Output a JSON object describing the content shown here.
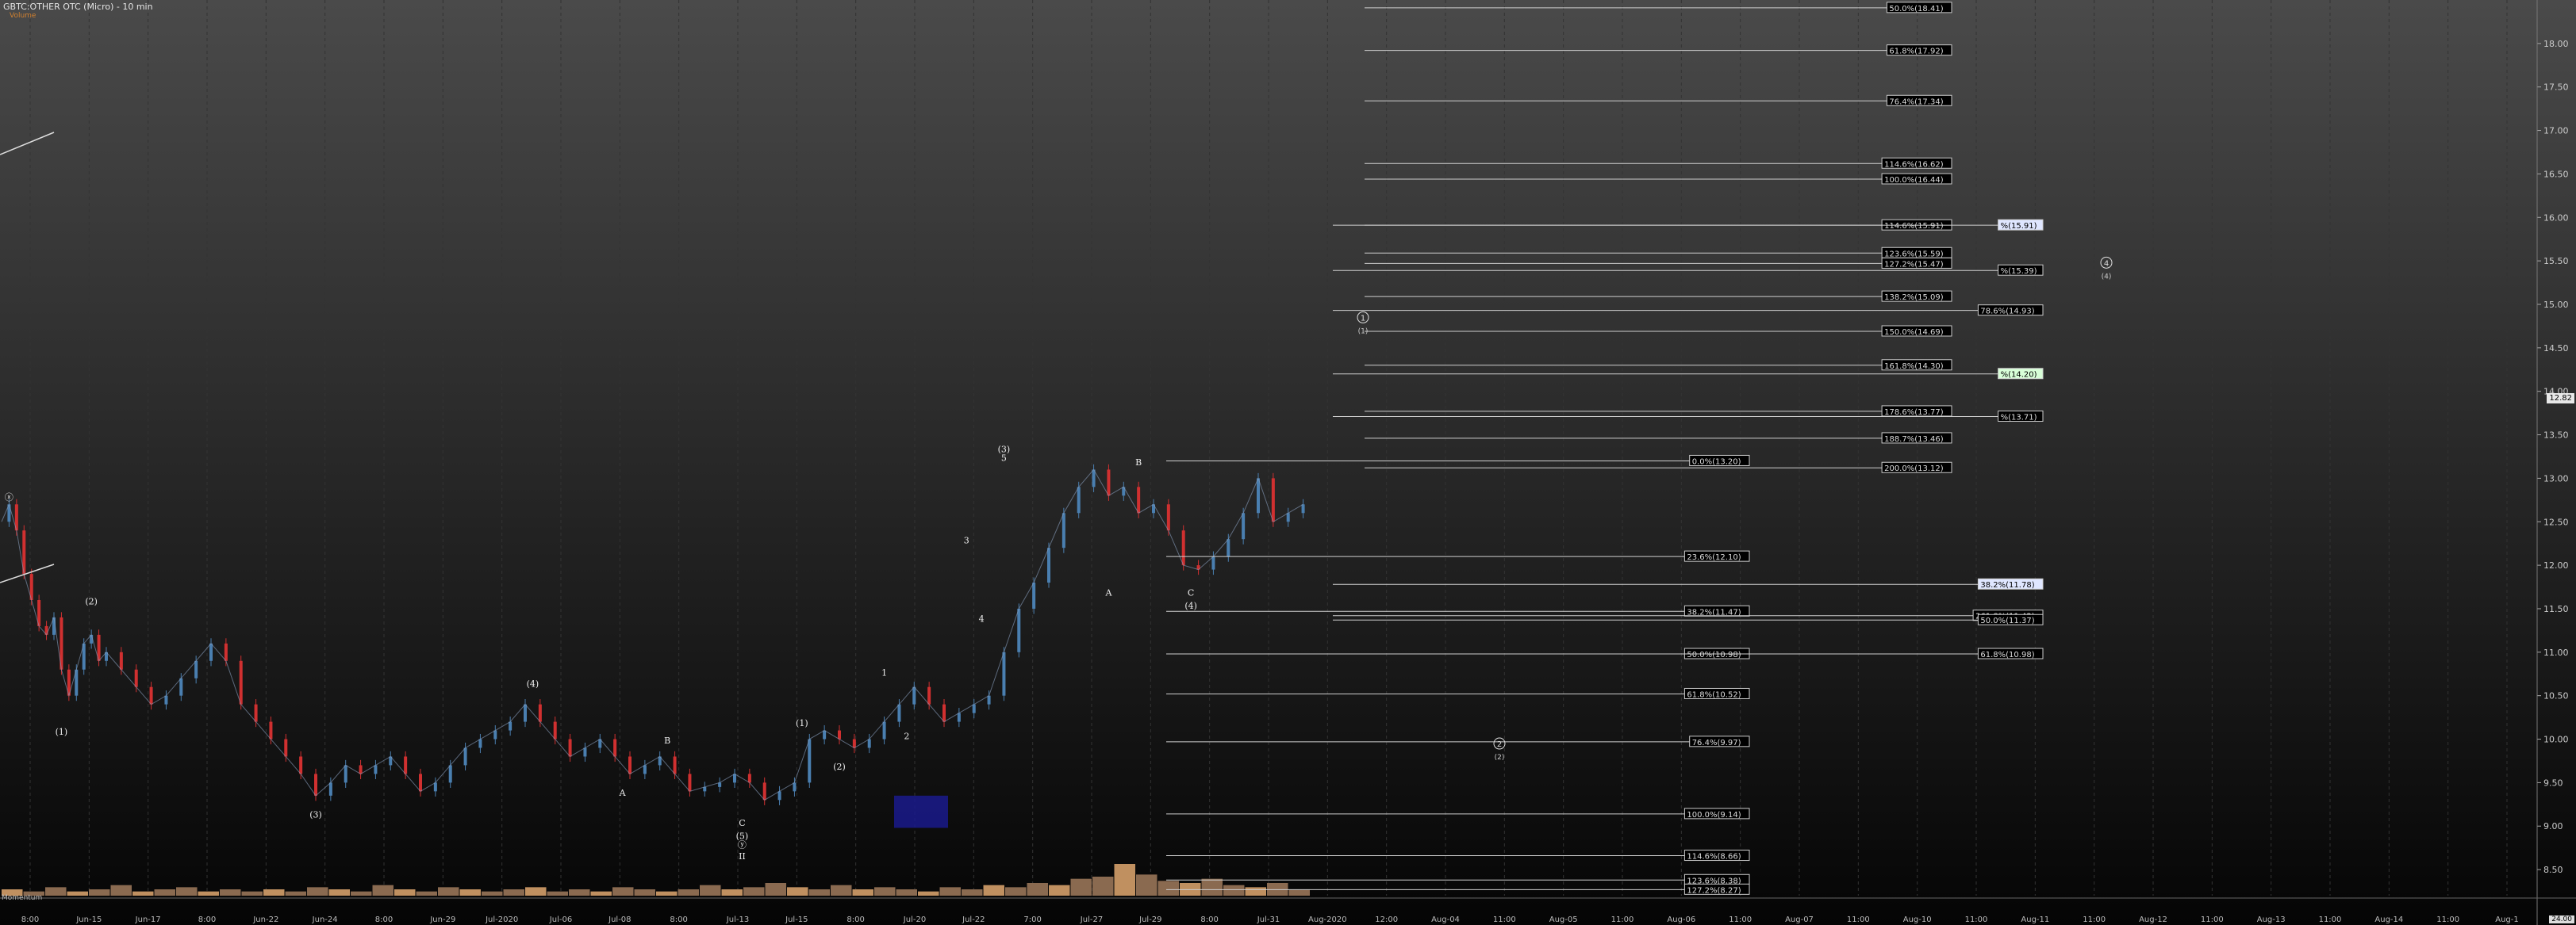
{
  "header": {
    "title": "GBTC:OTHER OTC (Micro) - 10 min",
    "sublabel": "Volume"
  },
  "price_tag": "12.82",
  "volume_label": "Momentum",
  "bottom_tag": "24.00",
  "colors": {
    "up": "#4a7fb0",
    "down": "#d03030",
    "grid": "#333333",
    "fib_line": "#cfcfcf",
    "box_fill": "#1a1a8c"
  },
  "chart_data": {
    "type": "line",
    "ylim": [
      8.2,
      18.5
    ],
    "y_ticks": [
      8.5,
      9.0,
      9.5,
      10.0,
      10.5,
      11.0,
      11.5,
      12.0,
      12.5,
      13.0,
      13.5,
      14.0,
      14.5,
      15.0,
      15.5,
      16.0,
      16.5,
      17.0,
      17.5,
      18.0
    ],
    "x_ticks": [
      "8:00",
      "Jun-15",
      "Jun-17",
      "8:00",
      "Jun-22",
      "Jun-24",
      "8:00",
      "Jun-29",
      "Jul-2020",
      "Jul-06",
      "Jul-08",
      "8:00",
      "Jul-13",
      "Jul-15",
      "8:00",
      "Jul-20",
      "Jul-22",
      "7:00",
      "Jul-27",
      "Jul-29",
      "8:00",
      "Jul-31",
      "Aug-2020",
      "12:00",
      "Aug-04",
      "11:00",
      "Aug-05",
      "11:00",
      "Aug-06",
      "11:00",
      "Aug-07",
      "11:00",
      "Aug-10",
      "11:00",
      "Aug-11",
      "11:00",
      "Aug-12",
      "11:00",
      "Aug-13",
      "11:00",
      "Aug-14",
      "11:00",
      "Aug-1"
    ],
    "price_series": {
      "name": "",
      "points": [
        [
          0,
          12.5
        ],
        [
          2,
          12.7
        ],
        [
          4,
          12.4
        ],
        [
          6,
          11.9
        ],
        [
          8,
          11.6
        ],
        [
          10,
          11.3
        ],
        [
          12,
          11.2
        ],
        [
          14,
          11.4
        ],
        [
          16,
          10.8
        ],
        [
          18,
          10.5
        ],
        [
          20,
          10.8
        ],
        [
          22,
          11.1
        ],
        [
          24,
          11.2
        ],
        [
          26,
          10.9
        ],
        [
          28,
          11.0
        ],
        [
          32,
          10.8
        ],
        [
          36,
          10.6
        ],
        [
          40,
          10.4
        ],
        [
          44,
          10.5
        ],
        [
          48,
          10.7
        ],
        [
          52,
          10.9
        ],
        [
          56,
          11.1
        ],
        [
          60,
          10.9
        ],
        [
          64,
          10.4
        ],
        [
          68,
          10.2
        ],
        [
          72,
          10.0
        ],
        [
          76,
          9.8
        ],
        [
          80,
          9.6
        ],
        [
          84,
          9.35
        ],
        [
          88,
          9.5
        ],
        [
          92,
          9.7
        ],
        [
          96,
          9.6
        ],
        [
          100,
          9.7
        ],
        [
          104,
          9.8
        ],
        [
          108,
          9.6
        ],
        [
          112,
          9.4
        ],
        [
          116,
          9.5
        ],
        [
          120,
          9.7
        ],
        [
          124,
          9.9
        ],
        [
          128,
          10.0
        ],
        [
          132,
          10.1
        ],
        [
          136,
          10.2
        ],
        [
          140,
          10.4
        ],
        [
          144,
          10.2
        ],
        [
          148,
          10.0
        ],
        [
          152,
          9.8
        ],
        [
          156,
          9.9
        ],
        [
          160,
          10.0
        ],
        [
          164,
          9.8
        ],
        [
          168,
          9.6
        ],
        [
          172,
          9.7
        ],
        [
          176,
          9.8
        ],
        [
          180,
          9.6
        ],
        [
          184,
          9.4
        ],
        [
          188,
          9.45
        ],
        [
          192,
          9.5
        ],
        [
          196,
          9.6
        ],
        [
          200,
          9.5
        ],
        [
          204,
          9.3
        ],
        [
          208,
          9.4
        ],
        [
          212,
          9.5
        ],
        [
          216,
          10.0
        ],
        [
          220,
          10.1
        ],
        [
          224,
          10.0
        ],
        [
          228,
          9.9
        ],
        [
          232,
          10.0
        ],
        [
          236,
          10.2
        ],
        [
          240,
          10.4
        ],
        [
          244,
          10.6
        ],
        [
          248,
          10.4
        ],
        [
          252,
          10.2
        ],
        [
          256,
          10.3
        ],
        [
          260,
          10.4
        ],
        [
          264,
          10.5
        ],
        [
          268,
          11.0
        ],
        [
          272,
          11.5
        ],
        [
          276,
          11.8
        ],
        [
          280,
          12.2
        ],
        [
          284,
          12.6
        ],
        [
          288,
          12.9
        ],
        [
          292,
          13.1
        ],
        [
          296,
          12.8
        ],
        [
          300,
          12.9
        ],
        [
          304,
          12.6
        ],
        [
          308,
          12.7
        ],
        [
          312,
          12.4
        ],
        [
          316,
          12.0
        ],
        [
          320,
          11.95
        ],
        [
          324,
          12.1
        ],
        [
          328,
          12.3
        ],
        [
          332,
          12.6
        ],
        [
          336,
          13.0
        ],
        [
          340,
          12.5
        ],
        [
          344,
          12.6
        ],
        [
          348,
          12.7
        ]
      ]
    },
    "volume_bars": [
      3,
      2,
      4,
      2,
      3,
      5,
      2,
      3,
      4,
      2,
      3,
      2,
      3,
      2,
      4,
      3,
      2,
      5,
      3,
      2,
      4,
      3,
      2,
      3,
      4,
      2,
      3,
      2,
      4,
      3,
      2,
      3,
      5,
      3,
      4,
      6,
      4,
      3,
      5,
      3,
      4,
      3,
      2,
      4,
      3,
      5,
      4,
      6,
      5,
      8,
      9,
      15,
      10,
      7,
      6,
      8,
      5,
      4,
      6,
      3
    ],
    "fib_levels": [
      {
        "label": "0.0%(13.20)",
        "value": 13.2
      },
      {
        "label": "23.6%(12.10)",
        "value": 12.1
      },
      {
        "label": "38.2%(11.47)",
        "value": 11.47
      },
      {
        "label": "50.0%(10.98)",
        "value": 10.98
      },
      {
        "label": "61.8%(10.52)",
        "value": 10.52
      },
      {
        "label": "76.4%(9.97)",
        "value": 9.97
      },
      {
        "label": "100.0%(9.14)",
        "value": 9.14
      },
      {
        "label": "114.6%(8.66)",
        "value": 8.66
      },
      {
        "label": "123.6%(8.38)",
        "value": 8.38
      },
      {
        "label": "127.2%(8.27)",
        "value": 8.27
      }
    ],
    "upper_fib_levels": [
      {
        "label": "50.0%(18.41)",
        "value": 18.41
      },
      {
        "label": "61.8%(17.92)",
        "value": 17.92
      },
      {
        "label": "76.4%(17.34)",
        "value": 17.34
      },
      {
        "label": "114.6%(16.62)",
        "value": 16.62
      },
      {
        "label": "100.0%(16.44)",
        "value": 16.44
      },
      {
        "label": "114.6%(15.91)",
        "value": 15.91
      },
      {
        "label": "123.6%(15.59)",
        "value": 15.59
      },
      {
        "label": "127.2%(15.47)",
        "value": 15.47
      },
      {
        "label": "138.2%(15.09)",
        "value": 15.09
      },
      {
        "label": "150.0%(14.69)",
        "value": 14.69
      },
      {
        "label": "161.8%(14.30)",
        "value": 14.3
      },
      {
        "label": "178.6%(13.77)",
        "value": 13.77
      },
      {
        "label": "188.7%(13.46)",
        "value": 13.46
      },
      {
        "label": "200.0%(13.12)",
        "value": 13.12
      }
    ],
    "right_fib_levels": [
      {
        "label": "%(15.91)",
        "value": 15.91,
        "highlight": "#dfe6ff"
      },
      {
        "label": "%(15.39)",
        "value": 15.39,
        "highlight": ""
      },
      {
        "label": "78.6%(14.93)",
        "value": 14.93,
        "highlight": ""
      },
      {
        "label": "%(14.20)",
        "value": 14.2,
        "highlight": "#d8ffd8"
      },
      {
        "label": "%(13.71)",
        "value": 13.71,
        "highlight": ""
      },
      {
        "label": "38.2%(11.78)",
        "value": 11.78,
        "highlight": "#dfe6ff"
      },
      {
        "label": "261.8%(11.42)",
        "value": 11.42,
        "highlight": ""
      },
      {
        "label": "50.0%(11.37)",
        "value": 11.37,
        "highlight": ""
      },
      {
        "label": "61.8%(10.98)",
        "value": 10.98,
        "highlight": ""
      }
    ],
    "wave_labels": [
      {
        "text": "(2)",
        "x": 24,
        "y": 11.55
      },
      {
        "text": "(1)",
        "x": 16,
        "y": 10.05
      },
      {
        "text": "(3)",
        "x": 84,
        "y": 9.1
      },
      {
        "text": "(4)",
        "x": 142,
        "y": 10.6
      },
      {
        "text": "B",
        "x": 178,
        "y": 9.95
      },
      {
        "text": "A",
        "x": 166,
        "y": 9.35
      },
      {
        "text": "C",
        "x": 198,
        "y": 9.0
      },
      {
        "text": "(5)",
        "x": 198,
        "y": 8.85
      },
      {
        "text": "ⓨ",
        "x": 198,
        "y": 8.75
      },
      {
        "text": "II",
        "x": 198,
        "y": 8.62
      },
      {
        "text": "(1)",
        "x": 214,
        "y": 10.15
      },
      {
        "text": "(2)",
        "x": 224,
        "y": 9.65
      },
      {
        "text": "1",
        "x": 236,
        "y": 10.73
      },
      {
        "text": "2",
        "x": 242,
        "y": 10.0
      },
      {
        "text": "3",
        "x": 258,
        "y": 12.25
      },
      {
        "text": "4",
        "x": 262,
        "y": 11.35
      },
      {
        "text": "(3)",
        "x": 268,
        "y": 13.3
      },
      {
        "text": "5",
        "x": 268,
        "y": 13.2
      },
      {
        "text": "B",
        "x": 304,
        "y": 13.15
      },
      {
        "text": "A",
        "x": 296,
        "y": 11.65
      },
      {
        "text": "C",
        "x": 318,
        "y": 11.65
      },
      {
        "text": "(4)",
        "x": 318,
        "y": 11.5
      },
      {
        "text": "ⓧ",
        "x": 2,
        "y": 12.75
      }
    ],
    "circled_markers": [
      {
        "text": "1",
        "x_frac_label": "(1)",
        "value": 14.85
      },
      {
        "text": "2",
        "x_frac_label": "(2)",
        "value": 9.95
      },
      {
        "text": "4",
        "x_frac_label": "(4)",
        "value": 15.48
      }
    ]
  }
}
